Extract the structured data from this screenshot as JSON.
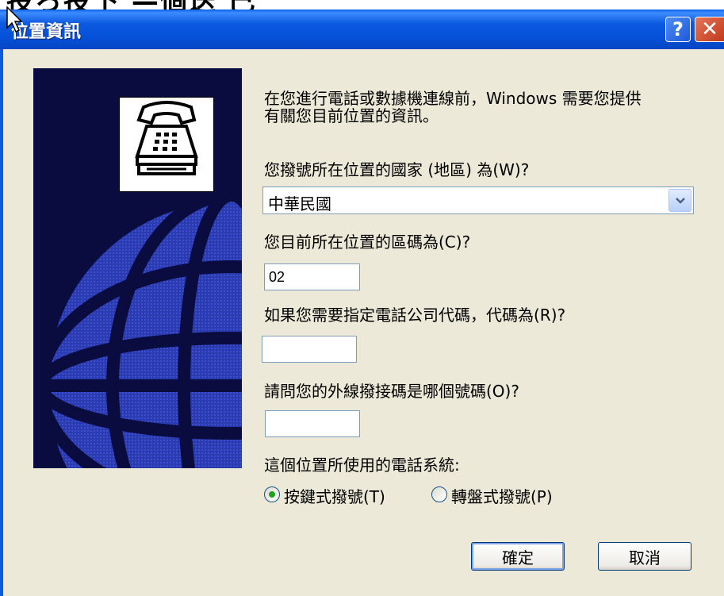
{
  "background": {
    "partial_text": "投ろ投下 —個迭 己"
  },
  "dialog": {
    "title": "位置資訊",
    "help_symbol": "?",
    "close_symbol": "✕"
  },
  "form": {
    "intro_line1": "在您進行電話或數據機連線前，Windows 需要您提供",
    "intro_line2": "有關您目前位置的資訊。",
    "country_label": "您撥號所在位置的國家 (地區) 為(W)?",
    "country_value": "中華民國",
    "area_code_label": "您目前所在位置的區碼為(C)?",
    "area_code_value": "02",
    "carrier_label": "如果您需要指定電話公司代碼，代碼為(R)?",
    "carrier_value": "",
    "outside_line_label": "請問您的外線撥接碼是哪個號碼(O)?",
    "outside_line_value": "",
    "dial_type_label": "這個位置所使用的電話系統:",
    "tone_label": "按鍵式撥號(T)",
    "pulse_label": "轉盤式撥號(P)",
    "selected_dial_type": "tone"
  },
  "buttons": {
    "ok": "確定",
    "cancel": "取消"
  },
  "icons": {
    "banner_icon": "telephone-icon",
    "dropdown": "chevron-down-icon",
    "cursor": "mouse-pointer-icon"
  },
  "colors": {
    "titlebar": "#0b5ae0",
    "dialog_bg": "#ece9d8",
    "banner_bg": "#0a0c40",
    "radio_dot": "#21a121"
  }
}
